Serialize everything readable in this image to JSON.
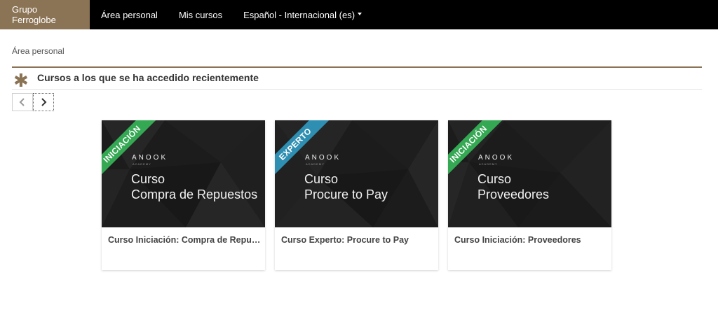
{
  "navbar": {
    "brand": "Grupo Ferroglobe",
    "links": [
      "Área personal",
      "Mis cursos"
    ],
    "language": "Español - Internacional (es)"
  },
  "breadcrumb": "Área personal",
  "section": {
    "title": "Cursos a los que se ha accedido recientemente"
  },
  "icons": {
    "section": "asterisk-icon",
    "prev": "chevron-left-icon",
    "next": "chevron-right-icon",
    "language": "caret-down-icon"
  },
  "colors": {
    "brand": "#8b7355",
    "navbar": "#000000",
    "ribbon_iniciacion": "#35a854",
    "ribbon_experto": "#2e8fb2"
  },
  "courses": [
    {
      "ribbon": "INICIACIÓN",
      "ribbon_color": "#35a854",
      "logo": "ANOOK",
      "logo_sub": "ACADEMY",
      "image_line1": "Curso",
      "image_line2": "Compra de Repuestos",
      "title": "Curso Iniciación: Compra de Repuestos"
    },
    {
      "ribbon": "EXPERTO",
      "ribbon_color": "#2e8fb2",
      "logo": "ANOOK",
      "logo_sub": "ACADEMY",
      "image_line1": "Curso",
      "image_line2": "Procure to Pay",
      "title": "Curso Experto: Procure to Pay"
    },
    {
      "ribbon": "INICIACIÓN",
      "ribbon_color": "#35a854",
      "logo": "ANOOK",
      "logo_sub": "ACADEMY",
      "image_line1": "Curso",
      "image_line2": "Proveedores",
      "title": "Curso Iniciación: Proveedores"
    }
  ]
}
